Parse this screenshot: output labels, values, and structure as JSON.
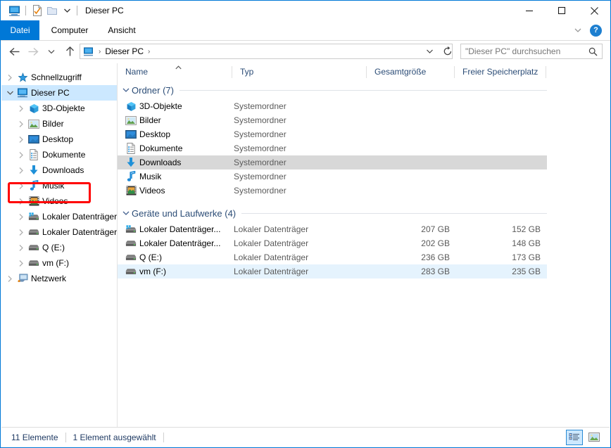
{
  "window": {
    "title": "Dieser PC",
    "quick_access": [
      {
        "name": "this-pc-icon",
        "label": "Dieser PC"
      },
      {
        "name": "properties-icon",
        "label": "Eigenschaften"
      },
      {
        "name": "new-folder-icon",
        "label": "Neuer Ordner"
      },
      {
        "name": "chevron-down-icon",
        "label": "Symbolleiste für den Schnellzugriff anpassen"
      }
    ],
    "controls": {
      "minimize": "Minimieren",
      "maximize": "Maximieren",
      "close": "Schließen"
    }
  },
  "ribbon": {
    "tabs": [
      {
        "label": "Datei",
        "active": true
      },
      {
        "label": "Computer",
        "active": false
      },
      {
        "label": "Ansicht",
        "active": false
      }
    ],
    "collapse_label": "Menüband minimieren",
    "help_label": "?"
  },
  "navbar": {
    "back": "Zurück",
    "forward": "Vorwärts",
    "recent": "Zuletzt besuchte Orte",
    "up": "Nach oben",
    "breadcrumb": {
      "icon": "this-pc-icon",
      "items": [
        "Dieser PC"
      ],
      "separator": "›"
    },
    "address_dropdown": "Vorherige Orte",
    "refresh": "Aktualisieren"
  },
  "search": {
    "placeholder": "\"Dieser PC\" durchsuchen",
    "icon": "search-icon"
  },
  "columns": [
    {
      "key": "name",
      "label": "Name",
      "sorted": "asc"
    },
    {
      "key": "type",
      "label": "Typ"
    },
    {
      "key": "size",
      "label": "Gesamtgröße"
    },
    {
      "key": "free",
      "label": "Freier Speicherplatz"
    }
  ],
  "sidebar": {
    "items": [
      {
        "label": "Schnellzugriff",
        "icon": "star-icon",
        "level": 0,
        "expandable": true,
        "expanded": false,
        "selected": false
      },
      {
        "label": "Dieser PC",
        "icon": "this-pc-icon",
        "level": 0,
        "expandable": true,
        "expanded": true,
        "selected": true
      },
      {
        "label": "3D-Objekte",
        "icon": "3d-objects-icon",
        "level": 1,
        "expandable": true,
        "expanded": false,
        "selected": false
      },
      {
        "label": "Bilder",
        "icon": "pictures-icon",
        "level": 1,
        "expandable": true,
        "expanded": false,
        "selected": false
      },
      {
        "label": "Desktop",
        "icon": "desktop-icon",
        "level": 1,
        "expandable": true,
        "expanded": false,
        "selected": false
      },
      {
        "label": "Dokumente",
        "icon": "documents-icon",
        "level": 1,
        "expandable": true,
        "expanded": false,
        "selected": false
      },
      {
        "label": "Downloads",
        "icon": "downloads-icon",
        "level": 1,
        "expandable": true,
        "expanded": false,
        "selected": false,
        "annotated": true
      },
      {
        "label": "Musik",
        "icon": "music-icon",
        "level": 1,
        "expandable": true,
        "expanded": false,
        "selected": false
      },
      {
        "label": "Videos",
        "icon": "videos-icon",
        "level": 1,
        "expandable": true,
        "expanded": false,
        "selected": false
      },
      {
        "label": "Lokaler Datenträger",
        "icon": "drive-windows-icon",
        "level": 1,
        "expandable": true,
        "expanded": false,
        "selected": false
      },
      {
        "label": "Lokaler Datenträger",
        "icon": "drive-icon",
        "level": 1,
        "expandable": true,
        "expanded": false,
        "selected": false
      },
      {
        "label": "Q (E:)",
        "icon": "drive-icon",
        "level": 1,
        "expandable": true,
        "expanded": false,
        "selected": false
      },
      {
        "label": "vm (F:)",
        "icon": "drive-icon",
        "level": 1,
        "expandable": true,
        "expanded": false,
        "selected": false
      },
      {
        "label": "Netzwerk",
        "icon": "network-icon",
        "level": 0,
        "expandable": true,
        "expanded": false,
        "selected": false
      }
    ]
  },
  "main": {
    "groups": [
      {
        "title": "Ordner (7)",
        "expanded": true,
        "rows": [
          {
            "name": "3D-Objekte",
            "icon": "3d-objects-icon",
            "type": "Systemordner",
            "size": "",
            "free": "",
            "state": "normal"
          },
          {
            "name": "Bilder",
            "icon": "pictures-icon",
            "type": "Systemordner",
            "size": "",
            "free": "",
            "state": "normal"
          },
          {
            "name": "Desktop",
            "icon": "desktop-icon",
            "type": "Systemordner",
            "size": "",
            "free": "",
            "state": "normal"
          },
          {
            "name": "Dokumente",
            "icon": "documents-icon",
            "type": "Systemordner",
            "size": "",
            "free": "",
            "state": "normal"
          },
          {
            "name": "Downloads",
            "icon": "downloads-icon",
            "type": "Systemordner",
            "size": "",
            "free": "",
            "state": "hover"
          },
          {
            "name": "Musik",
            "icon": "music-icon",
            "type": "Systemordner",
            "size": "",
            "free": "",
            "state": "normal"
          },
          {
            "name": "Videos",
            "icon": "videos-icon",
            "type": "Systemordner",
            "size": "",
            "free": "",
            "state": "normal"
          }
        ]
      },
      {
        "title": "Geräte und Laufwerke (4)",
        "expanded": true,
        "rows": [
          {
            "name": "Lokaler Datenträger...",
            "icon": "drive-windows-icon",
            "type": "Lokaler Datenträger",
            "size": "207 GB",
            "free": "152 GB",
            "state": "normal"
          },
          {
            "name": "Lokaler Datenträger...",
            "icon": "drive-icon",
            "type": "Lokaler Datenträger",
            "size": "202 GB",
            "free": "148 GB",
            "state": "normal"
          },
          {
            "name": "Q (E:)",
            "icon": "drive-icon",
            "type": "Lokaler Datenträger",
            "size": "236 GB",
            "free": "173 GB",
            "state": "normal"
          },
          {
            "name": "vm (F:)",
            "icon": "drive-icon",
            "type": "Lokaler Datenträger",
            "size": "283 GB",
            "free": "235 GB",
            "state": "selected"
          }
        ]
      }
    ]
  },
  "statusbar": {
    "item_count": "11 Elemente",
    "selection": "1 Element ausgewählt",
    "views": [
      {
        "name": "details-view-button",
        "label": "Details",
        "active": true
      },
      {
        "name": "large-icons-view-button",
        "label": "Große Symbole",
        "active": false
      }
    ]
  },
  "annotation": {
    "color": "#ff0000",
    "target": "Downloads"
  }
}
